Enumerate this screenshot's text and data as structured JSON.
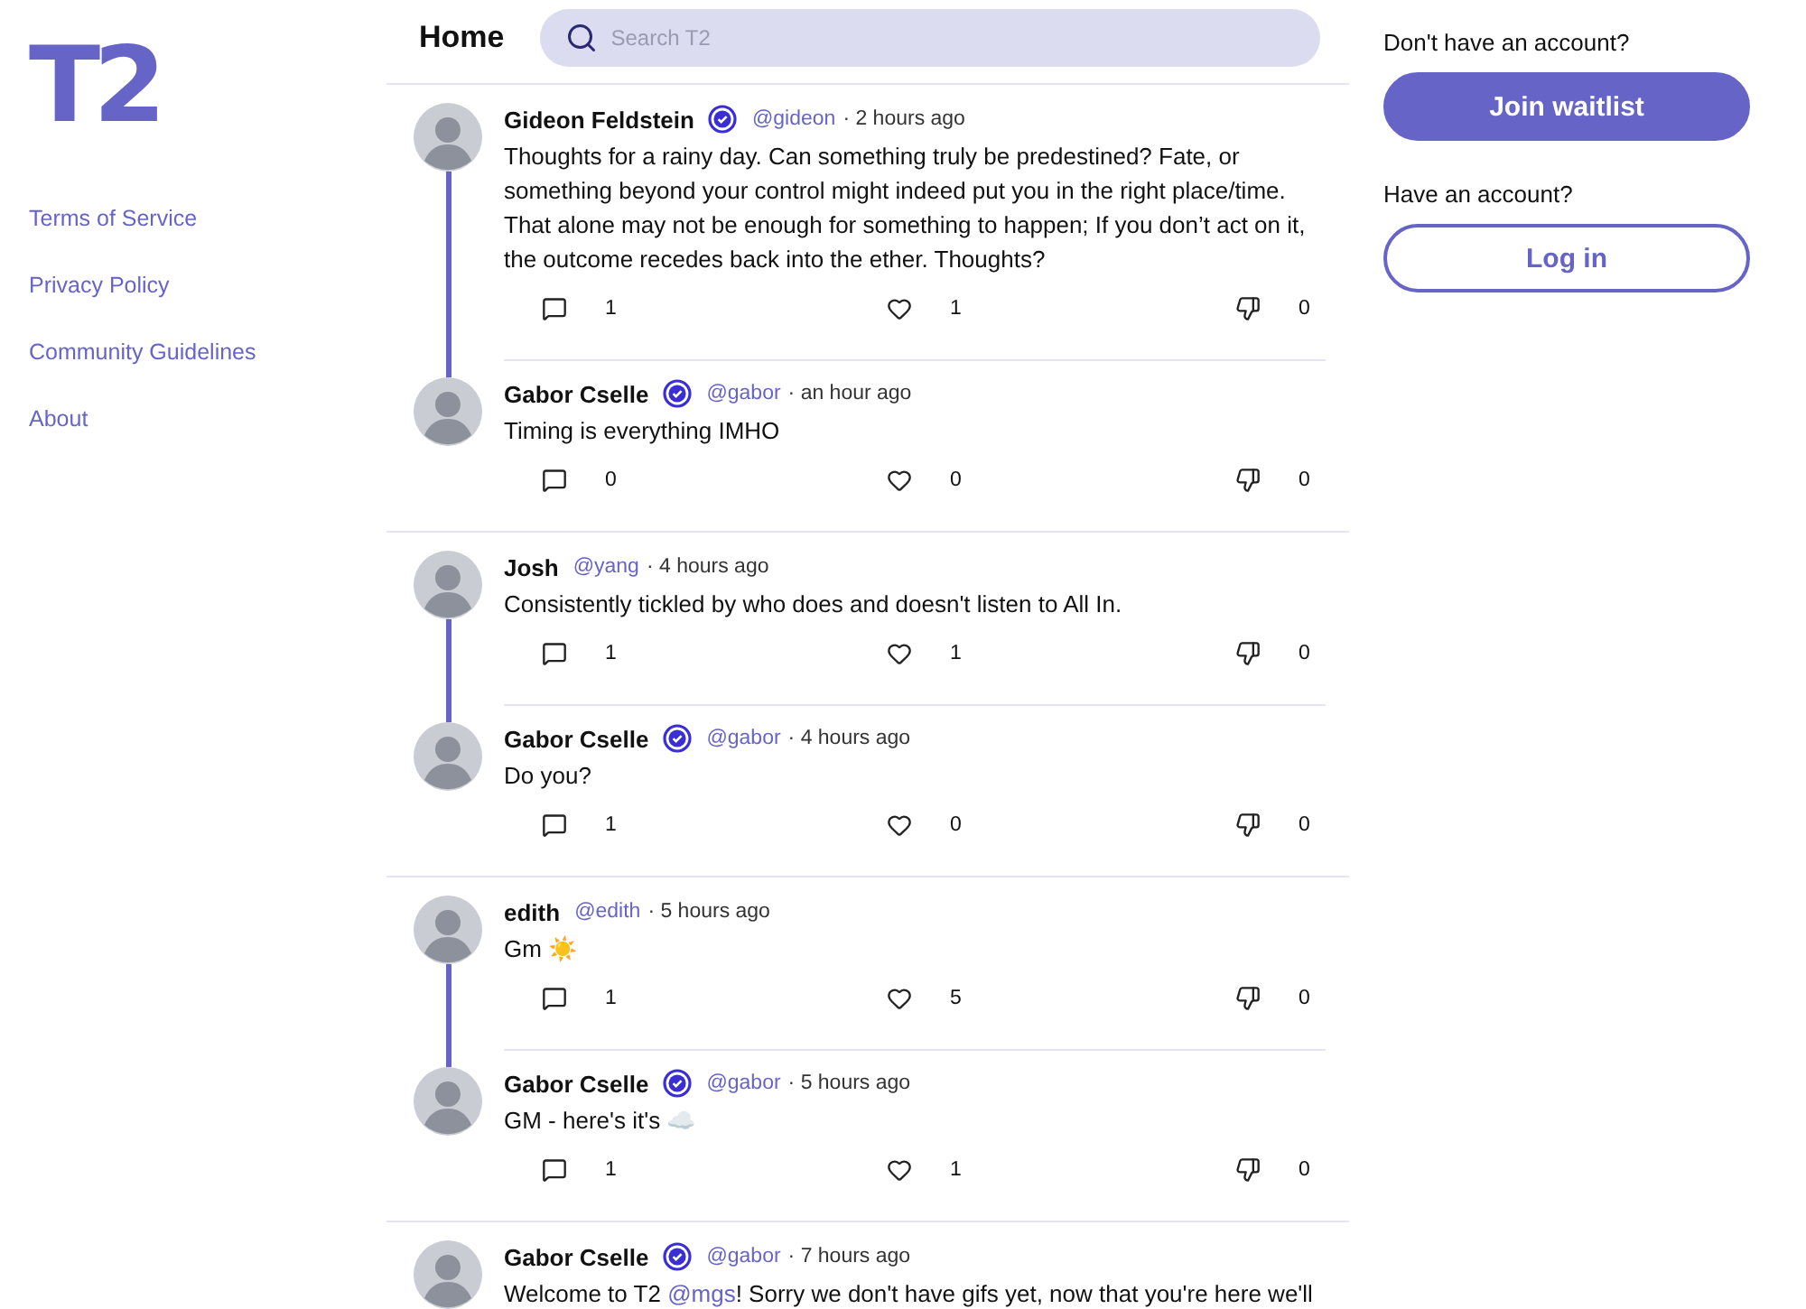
{
  "sidebar": {
    "logo": "T2",
    "links": [
      "Terms of Service",
      "Privacy Policy",
      "Community Guidelines",
      "About"
    ]
  },
  "header": {
    "title": "Home",
    "search": {
      "placeholder": "Search T2"
    }
  },
  "threads": [
    {
      "continues": false,
      "posts": [
        {
          "name": "Gideon Feldstein",
          "verified": true,
          "handle": "@gideon",
          "time": "· 2 hours ago",
          "text": [
            {
              "kind": "plain",
              "text": "Thoughts for a rainy day. Can something truly be predestined? Fate, or something beyond your control might indeed put you in the right place/time. That alone may not be enough for something to happen; If you don’t act on it, the outcome recedes back into the ether. Thoughts?"
            }
          ],
          "replies": "1",
          "likes": "1",
          "dislikes": "0"
        },
        {
          "name": "Gabor Cselle",
          "verified": true,
          "handle": "@gabor",
          "time": "· an hour ago",
          "text": [
            {
              "kind": "plain",
              "text": "Timing is everything IMHO"
            }
          ],
          "replies": "0",
          "likes": "0",
          "dislikes": "0"
        }
      ]
    },
    {
      "continues": false,
      "posts": [
        {
          "name": "Josh",
          "verified": false,
          "handle": "@yang",
          "time": "· 4 hours ago",
          "text": [
            {
              "kind": "plain",
              "text": "Consistently tickled by who does and doesn't listen to All In."
            }
          ],
          "replies": "1",
          "likes": "1",
          "dislikes": "0"
        },
        {
          "name": "Gabor Cselle",
          "verified": true,
          "handle": "@gabor",
          "time": "· 4 hours ago",
          "text": [
            {
              "kind": "plain",
              "text": "Do you?"
            }
          ],
          "replies": "1",
          "likes": "0",
          "dislikes": "0"
        }
      ]
    },
    {
      "continues": false,
      "posts": [
        {
          "name": "edith",
          "verified": false,
          "handle": "@edith",
          "time": "· 5 hours ago",
          "text": [
            {
              "kind": "plain",
              "text": "Gm ☀️"
            }
          ],
          "replies": "1",
          "likes": "5",
          "dislikes": "0"
        },
        {
          "name": "Gabor Cselle",
          "verified": true,
          "handle": "@gabor",
          "time": "· 5 hours ago",
          "text": [
            {
              "kind": "plain",
              "text": "GM - here's it's ☁️"
            }
          ],
          "replies": "1",
          "likes": "1",
          "dislikes": "0"
        }
      ]
    },
    {
      "continues": true,
      "posts": [
        {
          "name": "Gabor Cselle",
          "verified": true,
          "handle": "@gabor",
          "time": "· 7 hours ago",
          "text": [
            {
              "kind": "plain",
              "text": "Welcome to T2 "
            },
            {
              "kind": "mention",
              "text": "@mgs"
            },
            {
              "kind": "plain",
              "text": "! Sorry we don't have gifs yet, now that you're here we'll"
            }
          ]
        }
      ]
    }
  ],
  "account": {
    "signup_prompt": "Don't have an account?",
    "signup_button": "Join waitlist",
    "login_prompt": "Have an account?",
    "login_button": "Log in"
  }
}
